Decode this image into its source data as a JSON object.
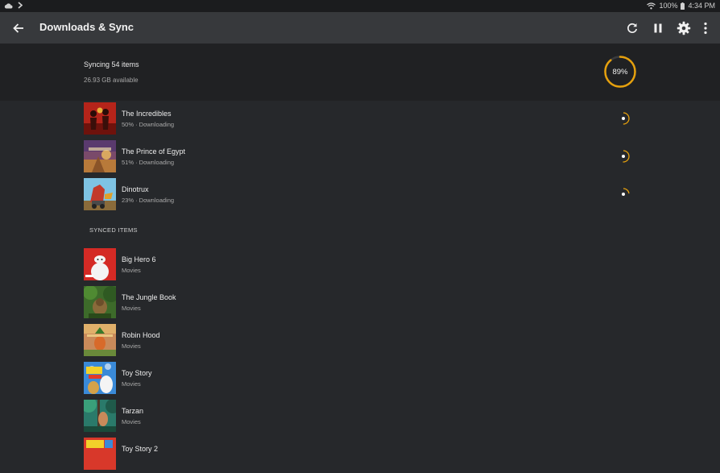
{
  "status_bar": {
    "battery": "100%",
    "time": "4:34 PM"
  },
  "app_bar": {
    "title": "Downloads & Sync",
    "icons": [
      "back-arrow-icon",
      "refresh-icon",
      "pause-icon",
      "settings-gear-icon",
      "more-vertical-icon"
    ]
  },
  "sync": {
    "title": "Syncing 54 items",
    "available": "26.93 GB available",
    "progress_label": "89%",
    "progress_value": 0.89,
    "accent_color": "#e5a00d"
  },
  "downloading": [
    {
      "title": "The Incredibles",
      "subtitle": "50% · Downloading",
      "progress": 0.5
    },
    {
      "title": "The Prince of Egypt",
      "subtitle": "51% · Downloading",
      "progress": 0.51
    },
    {
      "title": "Dinotrux",
      "subtitle": "23% · Downloading",
      "progress": 0.23
    }
  ],
  "synced_section_label": "SYNCED ITEMS",
  "synced": [
    {
      "title": "Big Hero 6",
      "subtitle": "Movies"
    },
    {
      "title": "The Jungle Book",
      "subtitle": "Movies"
    },
    {
      "title": "Robin Hood",
      "subtitle": "Movies"
    },
    {
      "title": "Toy Story",
      "subtitle": "Movies"
    },
    {
      "title": "Tarzan",
      "subtitle": "Movies"
    },
    {
      "title": "Toy Story 2",
      "subtitle": ""
    }
  ]
}
